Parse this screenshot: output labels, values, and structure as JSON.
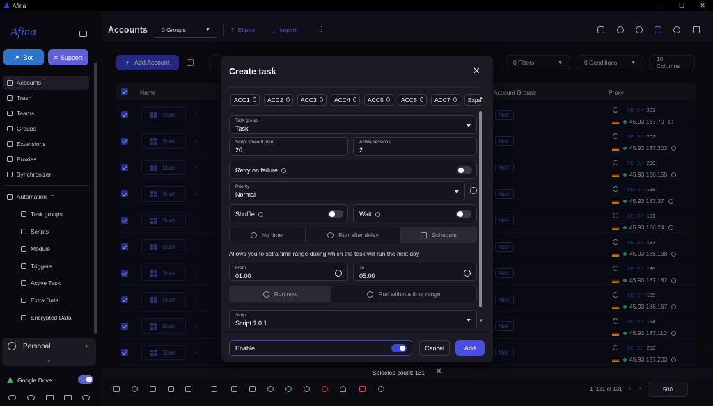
{
  "app": {
    "title": "Afina",
    "brand": "Afina"
  },
  "sidebar": {
    "bot_label": "Bot",
    "support_label": "Support",
    "items": [
      {
        "label": "Accounts",
        "icon": "accounts-icon"
      },
      {
        "label": "Trash",
        "icon": "trash-icon"
      },
      {
        "label": "Teams",
        "icon": "teams-icon"
      },
      {
        "label": "Groups",
        "icon": "groups-icon"
      },
      {
        "label": "Extensions",
        "icon": "extensions-icon"
      },
      {
        "label": "Proxies",
        "icon": "proxies-icon"
      },
      {
        "label": "Synchronizer",
        "icon": "sync-icon"
      }
    ],
    "automation_label": "Automation",
    "automation_items": [
      {
        "label": "Task groups"
      },
      {
        "label": "Scripts"
      },
      {
        "label": "Module"
      },
      {
        "label": "Triggers"
      },
      {
        "label": "Active Task"
      },
      {
        "label": "Extra Data"
      },
      {
        "label": "Encrypted Data"
      }
    ],
    "personal_label": "Personal",
    "google_drive_label": "Google Drive"
  },
  "header": {
    "title": "Accounts",
    "groups_select": "0 Groups",
    "export_label": "Export",
    "import_label": "Import"
  },
  "toolbar": {
    "add_account_label": "Add Account",
    "filters_label": "0 Filters",
    "conditions_label": "0 Conditions",
    "columns_label": "10 Columns"
  },
  "table": {
    "col_name": "Name",
    "col_groups": "Account Groups",
    "col_proxy": "Proxy",
    "start_label": "Start",
    "group_label": "Main",
    "rows": [
      {
        "proxy_type": "DE ISP",
        "proxy_id": "203",
        "ip": "45.93.187.70"
      },
      {
        "proxy_type": "DE ISP",
        "proxy_id": "202",
        "ip": "45.93.187.203"
      },
      {
        "proxy_type": "DE ISP",
        "proxy_id": "200",
        "ip": "45.93.186.155"
      },
      {
        "proxy_type": "DE ISP",
        "proxy_id": "198",
        "ip": "45.93.187.37"
      },
      {
        "proxy_type": "DE ISP",
        "proxy_id": "191",
        "ip": "45.93.186.24"
      },
      {
        "proxy_type": "DE ISP",
        "proxy_id": "187",
        "ip": "45.93.186.138"
      },
      {
        "proxy_type": "DE ISP",
        "proxy_id": "196",
        "ip": "45.93.187.182"
      },
      {
        "proxy_type": "DE ISP",
        "proxy_id": "185",
        "ip": "45.93.186.167"
      },
      {
        "proxy_type": "DE ISP",
        "proxy_id": "194",
        "ip": "45.93.187.110"
      },
      {
        "proxy_type": "DE ISP",
        "proxy_id": "202",
        "ip": "45.93.187.203"
      }
    ]
  },
  "footer": {
    "selected_count": "Selected count: 131",
    "pagination": "1–131 of 131",
    "page_size": "500"
  },
  "modal": {
    "title": "Create task",
    "chips": [
      "ACC1",
      "ACC2",
      "ACC3",
      "ACC4",
      "ACC5",
      "ACC6",
      "ACC7",
      "Expa"
    ],
    "task_group": {
      "label": "Task group",
      "value": "Task"
    },
    "script_timeout": {
      "label": "Script timeout (min)",
      "value": "20"
    },
    "active_sessions": {
      "label": "Active sessions",
      "value": "2"
    },
    "retry_label": "Retry on failure",
    "priority": {
      "label": "Priority",
      "value": "Normal"
    },
    "shuffle_label": "Shuffle",
    "wait_label": "Wait",
    "timer_tabs": [
      "No timer",
      "Run after delay",
      "Schedule"
    ],
    "schedule_hint": "Allows you to set a time range during which the task will run the next day",
    "from": {
      "label": "From",
      "value": "01:00"
    },
    "to": {
      "label": "To",
      "value": "05:00"
    },
    "run_tabs": [
      "Run now",
      "Run within a time range"
    ],
    "script": {
      "label": "Script",
      "value": "Script 1.0.1"
    },
    "enable_label": "Enable",
    "cancel_label": "Cancel",
    "add_label": "Add"
  }
}
